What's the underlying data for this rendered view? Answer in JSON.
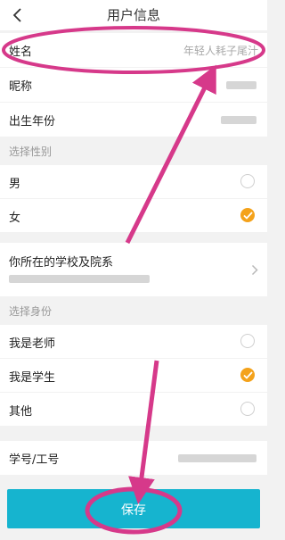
{
  "header": {
    "title": "用户信息",
    "back_icon": "chevron-left-icon"
  },
  "fields": {
    "name": {
      "label": "姓名",
      "placeholder": "年轻人耗子尾汁"
    },
    "nickname": {
      "label": "昵称"
    },
    "birth": {
      "label": "出生年份"
    }
  },
  "gender": {
    "section_label": "选择性别",
    "options": [
      {
        "label": "男",
        "selected": false
      },
      {
        "label": "女",
        "selected": true
      }
    ]
  },
  "school": {
    "label": "你所在的学校及院系",
    "chevron_icon": "chevron-right-icon"
  },
  "identity": {
    "section_label": "选择身份",
    "options": [
      {
        "label": "我是老师",
        "selected": false
      },
      {
        "label": "我是学生",
        "selected": true
      },
      {
        "label": "其他",
        "selected": false
      }
    ]
  },
  "student_id": {
    "label": "学号/工号"
  },
  "save_label": "保存",
  "colors": {
    "accent": "#f4a21b",
    "save_bg": "#16b4cf",
    "annotation": "#d6398a"
  }
}
